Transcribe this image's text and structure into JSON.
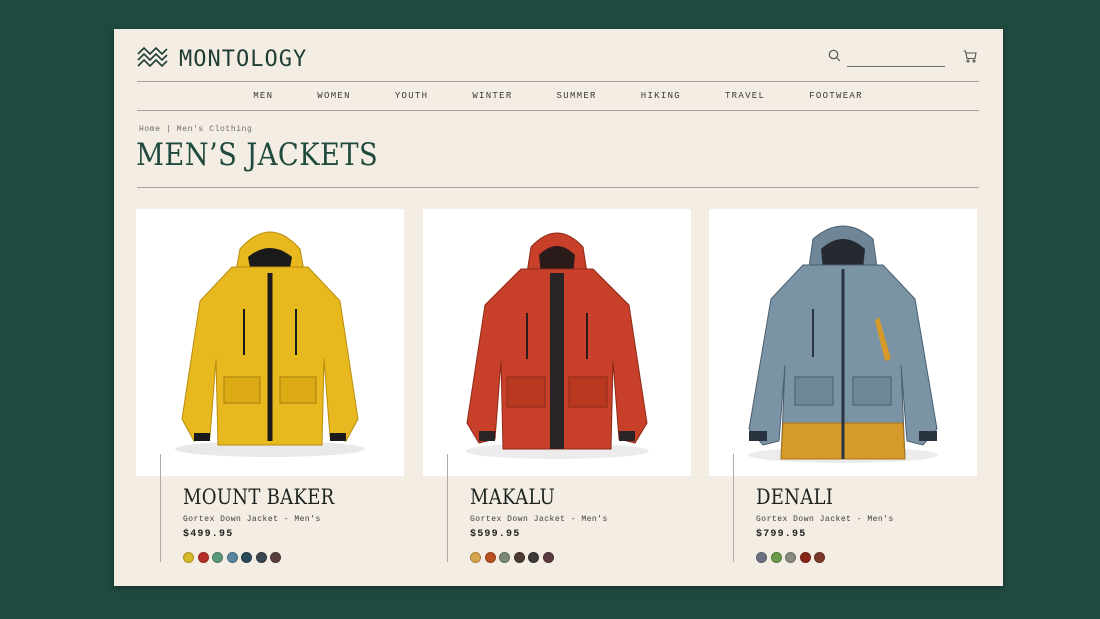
{
  "brand": {
    "name": "MONTOLOGY",
    "logo_icon": "waves-logo-icon"
  },
  "search": {
    "placeholder": "",
    "icon": "search-icon"
  },
  "cart": {
    "icon": "cart-icon"
  },
  "nav": {
    "items": [
      "MEN",
      "WOMEN",
      "YOUTH",
      "WINTER",
      "SUMMER",
      "HIKING",
      "TRAVEL",
      "FOOTWEAR"
    ]
  },
  "breadcrumb": "Home | Men's Clothing",
  "page_title": "MEN’S JACKETS",
  "colors": {
    "background": "#1f4a40",
    "page": "#f3ede4",
    "accent": "#1f4a3e"
  },
  "products": [
    {
      "name": "MOUNT BAKER",
      "subtitle": "Gortex Down Jacket - Men's",
      "price": "$499.95",
      "jacket_color": "#e8b81f",
      "swatches": [
        "#d4b82a",
        "#b8302a",
        "#5a9a78",
        "#5a86a0",
        "#2a4a5a",
        "#3a4650",
        "#5a3e3e"
      ]
    },
    {
      "name": "MAKALU",
      "subtitle": "Gortex Down Jacket - Men's",
      "price": "$599.95",
      "jacket_color": "#c8402a",
      "swatches": [
        "#d6a44a",
        "#b8501e",
        "#7a8a72",
        "#4a3a30",
        "#3e3a3a",
        "#5a3a3e"
      ]
    },
    {
      "name": "DENALI",
      "subtitle": "Gortex Down Jacket - Men's",
      "price": "$799.95",
      "jacket_color": "#7a94a6",
      "swatches": [
        "#6a7280",
        "#6a9a4a",
        "#8a8a84",
        "#8a2618",
        "#7a3a2a"
      ]
    }
  ]
}
